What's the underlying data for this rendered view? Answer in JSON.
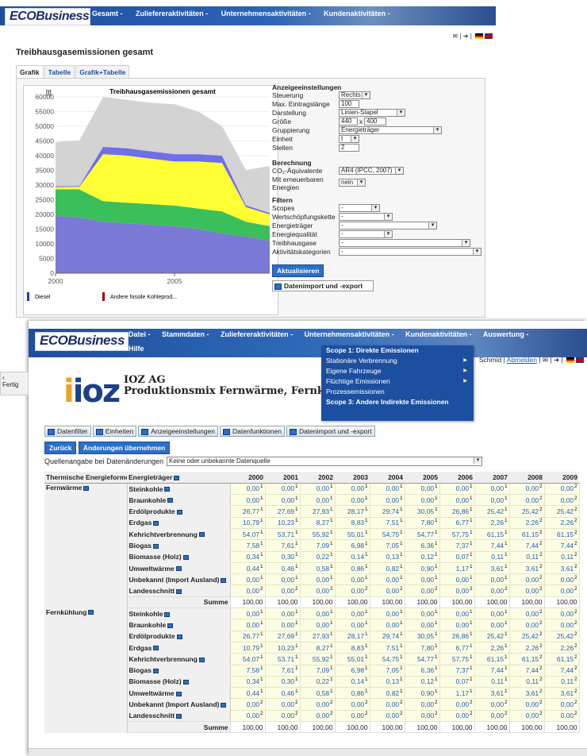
{
  "win1": {
    "logo": "ECOBusiness",
    "menu": [
      "Gesamt -",
      "Zuliefereraktivitäten -",
      "Unternehmensaktivitäten -",
      "Kundenaktivitäten -"
    ],
    "page_title": "Treibhausgasemissionen gesamt",
    "tabs": [
      "Grafik",
      "Tabelle",
      "Grafik+Tabelle"
    ],
    "active_tab": "Grafik",
    "chart_data": {
      "type": "area",
      "title": "Treibhausgasemissionen gesamt",
      "ylabel": "[t]",
      "ylim": [
        0,
        60000
      ],
      "yticks": [
        "60000",
        "55000",
        "50000",
        "45000",
        "40000",
        "35000",
        "30000",
        "25000",
        "20000",
        "15000",
        "10000",
        "5000",
        "0"
      ],
      "xticks": [
        "2000",
        "2005"
      ],
      "x": [
        2000,
        2001,
        2002,
        2003,
        2004,
        2005,
        2006,
        2007,
        2008,
        2009
      ],
      "series": [
        {
          "color": "#7a7ad6",
          "values": [
            19500,
            19000,
            17500,
            17000,
            16500,
            16000,
            15000,
            13500,
            12500,
            11000
          ]
        },
        {
          "color": "#3bbf5a",
          "values": [
            9000,
            9500,
            7000,
            7000,
            7000,
            7000,
            7000,
            7500,
            5000,
            5000
          ]
        },
        {
          "color": "#ffff33",
          "values": [
            800,
            900,
            16000,
            16000,
            15500,
            15000,
            16000,
            16500,
            5000,
            4000
          ]
        },
        {
          "color": "#6f6fe8",
          "values": [
            300,
            300,
            2500,
            2500,
            2500,
            2500,
            2500,
            2500,
            600,
            500
          ]
        },
        {
          "color": "#d3d3d3",
          "values": [
            15000,
            15500,
            17000,
            16500,
            16500,
            17000,
            14500,
            10000,
            12000,
            16000
          ]
        }
      ],
      "legend": [
        {
          "name": "Diesel",
          "color": "#1f3fa8"
        },
        {
          "name": "Andere fossile Kohleprod...",
          "color": "#b00000"
        }
      ]
    },
    "settings": {
      "anzeige_title": "Anzeigeeinstellungen",
      "steuerung_label": "Steuerung",
      "steuerung_value": "Rechts",
      "max_label": "Max. Eintragslänge",
      "max_value": "100",
      "darstellung_label": "Darstellung",
      "darstellung_value": "Linien-Stapel",
      "groesse_label": "Größe",
      "groesse_w": "440",
      "groesse_x": "x",
      "groesse_h": "400",
      "gruppierung_label": "Gruppierung",
      "gruppierung_value": "Energieträger",
      "einheit_label": "Einheit",
      "einheit_value": "t",
      "stellen_label": "Stellen",
      "stellen_value": "2",
      "berechnung_title": "Berechnung",
      "co2_label": "CO₂-Äquivalente",
      "co2_value": "AR4 (IPCC, 2007)",
      "erneuerbar_label1": "Mit erneuerbaren",
      "erneuerbar_label2": "Energien",
      "erneuerbar_value": "nein",
      "filter_title": "Filtern",
      "scopes_label": "Scopes",
      "scopes_value": "-",
      "wert_label": "Wertschöpfungskette",
      "wert_value": "-",
      "energietraeger_label": "Energieträger",
      "energietraeger_value": "-",
      "energiequal_label": "Energiequalität",
      "energiequal_value": "-",
      "treibhaus_label": "Treibhausgase",
      "treibhaus_value": "-",
      "aktiv_label": "Aktivitätskategorien",
      "aktiv_value": "-",
      "aktualisieren": "Aktualisieren",
      "import_export": "Datenimport und -export"
    }
  },
  "win2": {
    "logo": "ECOBusiness",
    "menu": [
      "Datei -",
      "Stammdaten -",
      "Zuliefereraktivitäten -",
      "Unternehmensaktivitäten -",
      "Kundenaktivitäten -",
      "Auswertung -"
    ],
    "menu2": "Hilfe",
    "dropdown": [
      {
        "label": "Scope 1: Direkte Emissionen",
        "bold": true,
        "arrow": false
      },
      {
        "label": "Stationäre Verbrennung",
        "bold": false,
        "arrow": true
      },
      {
        "label": "Eigene Fahrzeuge",
        "bold": false,
        "arrow": true
      },
      {
        "label": "Flüchtige Emissionen",
        "bold": false,
        "arrow": true
      },
      {
        "label": "Prozessemissionen",
        "bold": false,
        "arrow": false
      },
      {
        "label": "Scope 3: Andere Indirekte Emissionen",
        "bold": true,
        "arrow": false
      }
    ],
    "user": "Schmid",
    "logout": "Abmelden",
    "company_name": "IOZ AG",
    "company_sub": "Produktionsmix Fernwärme, Fernkühlun",
    "logo_text": "ioz",
    "toolbar": [
      "Datenfilter",
      "Einheiten",
      "Anzeigeeinstellungen",
      "Datenfunktionen",
      "Datenimport und -export"
    ],
    "zurueck": "Zurück",
    "uebernehmen": "Änderungen übernehmen",
    "quelle_label": "Quellenangabe bei Datenänderungen",
    "quelle_value": "Keine oder unbekannte Datenquelle",
    "col1": "Thermische Energieformen",
    "col2": "Energieträger",
    "years": [
      "2000",
      "2001",
      "2002",
      "2003",
      "2004",
      "2005",
      "2006",
      "2007",
      "2008",
      "2009"
    ],
    "sum_label": "Summe",
    "groups": [
      {
        "name": "Fernwärme",
        "rows": [
          {
            "carrier": "Steinkohle",
            "values": [
              "0,00",
              "0,00",
              "0,00",
              "0,00",
              "0,00",
              "0,00",
              "0,00",
              "0,00",
              "0,00",
              "0,00"
            ],
            "idx": [
              "1",
              "1",
              "1",
              "1",
              "1",
              "1",
              "1",
              "1",
              "2",
              "2"
            ]
          },
          {
            "carrier": "Braunkohle",
            "values": [
              "0,00",
              "0,00",
              "0,00",
              "0,00",
              "0,00",
              "0,00",
              "0,00",
              "0,00",
              "0,00",
              "0,00"
            ],
            "idx": [
              "1",
              "1",
              "1",
              "1",
              "1",
              "1",
              "1",
              "1",
              "2",
              "2"
            ]
          },
          {
            "carrier": "Erdölprodukte",
            "values": [
              "26,77",
              "27,69",
              "27,93",
              "28,17",
              "29,74",
              "30,05",
              "26,86",
              "25,42",
              "25,42",
              "25,42"
            ],
            "idx": [
              "1",
              "1",
              "1",
              "1",
              "1",
              "1",
              "1",
              "1",
              "2",
              "2"
            ]
          },
          {
            "carrier": "Erdgas",
            "values": [
              "10,79",
              "10,23",
              "8,27",
              "8,83",
              "7,51",
              "7,80",
              "6,77",
              "2,26",
              "2,26",
              "2,26"
            ],
            "idx": [
              "1",
              "1",
              "1",
              "1",
              "1",
              "1",
              "1",
              "1",
              "2",
              "2"
            ]
          },
          {
            "carrier": "Kehrichtverbrennung",
            "values": [
              "54,07",
              "53,71",
              "55,92",
              "55,01",
              "54,75",
              "54,77",
              "57,75",
              "61,15",
              "61,15",
              "61,15"
            ],
            "idx": [
              "1",
              "1",
              "1",
              "1",
              "1",
              "1",
              "1",
              "1",
              "2",
              "2"
            ]
          },
          {
            "carrier": "Biogas",
            "values": [
              "7,58",
              "7,61",
              "7,09",
              "6,98",
              "7,05",
              "6,36",
              "7,37",
              "7,44",
              "7,44",
              "7,44"
            ],
            "idx": [
              "1",
              "1",
              "1",
              "1",
              "1",
              "1",
              "1",
              "1",
              "2",
              "2"
            ]
          },
          {
            "carrier": "Biomasse (Holz)",
            "values": [
              "0,34",
              "0,30",
              "0,22",
              "0,14",
              "0,13",
              "0,12",
              "0,07",
              "0,11",
              "0,11",
              "0,11"
            ],
            "idx": [
              "1",
              "1",
              "1",
              "1",
              "1",
              "1",
              "1",
              "1",
              "2",
              "2"
            ]
          },
          {
            "carrier": "Umweltwärme",
            "values": [
              "0,44",
              "0,46",
              "0,58",
              "0,86",
              "0,82",
              "0,90",
              "1,17",
              "3,61",
              "3,61",
              "3,61"
            ],
            "idx": [
              "1",
              "1",
              "1",
              "1",
              "1",
              "1",
              "1",
              "1",
              "2",
              "2"
            ]
          },
          {
            "carrier": "Unbekannt (Import Ausland)",
            "values": [
              "0,00",
              "0,00",
              "0,00",
              "0,00",
              "0,00",
              "0,00",
              "0,00",
              "0,00",
              "0,00",
              "0,00"
            ],
            "idx": [
              "1",
              "1",
              "1",
              "1",
              "1",
              "1",
              "1",
              "1",
              "2",
              "2"
            ]
          },
          {
            "carrier": "Landesschnitt",
            "values": [
              "0,00",
              "0,00",
              "0,00",
              "0,00",
              "0,00",
              "0,00",
              "0,00",
              "0,00",
              "0,00",
              "0,00"
            ],
            "idx": [
              "2",
              "2",
              "2",
              "2",
              "2",
              "2",
              "2",
              "2",
              "2",
              "2"
            ]
          }
        ],
        "sum": [
          "100,00",
          "100,00",
          "100,00",
          "100,00",
          "100,00",
          "100,00",
          "100,00",
          "100,00",
          "100,00",
          "100,00"
        ]
      },
      {
        "name": "Fernkühlung",
        "rows": [
          {
            "carrier": "Steinkohle",
            "values": [
              "0,00",
              "0,00",
              "0,00",
              "0,00",
              "0,00",
              "0,00",
              "0,00",
              "0,00",
              "0,00",
              "0,00"
            ],
            "idx": [
              "1",
              "1",
              "1",
              "1",
              "1",
              "1",
              "1",
              "1",
              "2",
              "2"
            ]
          },
          {
            "carrier": "Braunkohle",
            "values": [
              "0,00",
              "0,00",
              "0,00",
              "0,00",
              "0,00",
              "0,00",
              "0,00",
              "0,00",
              "0,00",
              "0,00"
            ],
            "idx": [
              "1",
              "1",
              "1",
              "1",
              "1",
              "1",
              "1",
              "1",
              "2",
              "2"
            ]
          },
          {
            "carrier": "Erdölprodukte",
            "values": [
              "26,77",
              "27,69",
              "27,93",
              "28,17",
              "29,74",
              "30,05",
              "26,86",
              "25,42",
              "25,42",
              "25,42"
            ],
            "idx": [
              "1",
              "1",
              "1",
              "1",
              "1",
              "1",
              "1",
              "1",
              "2",
              "2"
            ]
          },
          {
            "carrier": "Erdgas",
            "values": [
              "10,79",
              "10,23",
              "8,27",
              "8,83",
              "7,51",
              "7,80",
              "6,77",
              "2,26",
              "2,26",
              "2,26"
            ],
            "idx": [
              "1",
              "1",
              "1",
              "1",
              "1",
              "1",
              "1",
              "1",
              "2",
              "2"
            ]
          },
          {
            "carrier": "Kehrichtverbrennung",
            "values": [
              "54,07",
              "53,71",
              "55,92",
              "55,01",
              "54,75",
              "54,77",
              "57,75",
              "61,15",
              "61,15",
              "61,15"
            ],
            "idx": [
              "1",
              "1",
              "1",
              "1",
              "1",
              "1",
              "1",
              "1",
              "2",
              "2"
            ]
          },
          {
            "carrier": "Biogas",
            "values": [
              "7,58",
              "7,61",
              "7,09",
              "6,98",
              "7,05",
              "6,36",
              "7,37",
              "7,44",
              "7,44",
              "7,44"
            ],
            "idx": [
              "1",
              "1",
              "1",
              "1",
              "1",
              "1",
              "1",
              "1",
              "2",
              "2"
            ]
          },
          {
            "carrier": "Biomasse (Holz)",
            "values": [
              "0,34",
              "0,30",
              "0,22",
              "0,14",
              "0,13",
              "0,12",
              "0,07",
              "0,11",
              "0,11",
              "0,11"
            ],
            "idx": [
              "1",
              "1",
              "1",
              "1",
              "1",
              "1",
              "1",
              "1",
              "2",
              "2"
            ]
          },
          {
            "carrier": "Umweltwärme",
            "values": [
              "0,44",
              "0,46",
              "0,58",
              "0,86",
              "0,82",
              "0,90",
              "1,17",
              "3,61",
              "3,61",
              "3,61"
            ],
            "idx": [
              "1",
              "1",
              "1",
              "1",
              "1",
              "1",
              "1",
              "1",
              "2",
              "2"
            ]
          },
          {
            "carrier": "Unbekannt (Import Ausland)",
            "values": [
              "0,00",
              "0,00",
              "0,00",
              "0,00",
              "0,00",
              "0,00",
              "0,00",
              "0,00",
              "0,00",
              "0,00"
            ],
            "idx": [
              "2",
              "2",
              "2",
              "2",
              "2",
              "2",
              "2",
              "2",
              "2",
              "2"
            ]
          },
          {
            "carrier": "Landesschnitt",
            "values": [
              "0,00",
              "0,00",
              "0,00",
              "0,00",
              "0,00",
              "0,00",
              "0,00",
              "0,00",
              "0,00",
              "0,00"
            ],
            "idx": [
              "2",
              "2",
              "2",
              "2",
              "2",
              "2",
              "2",
              "2",
              "2",
              "2"
            ]
          }
        ],
        "sum": [
          "100,00",
          "100,00",
          "100,00",
          "100,00",
          "100,00",
          "100,00",
          "100,00",
          "100,00",
          "100,00",
          "100,00"
        ]
      }
    ]
  },
  "statusbar": "Fertig"
}
